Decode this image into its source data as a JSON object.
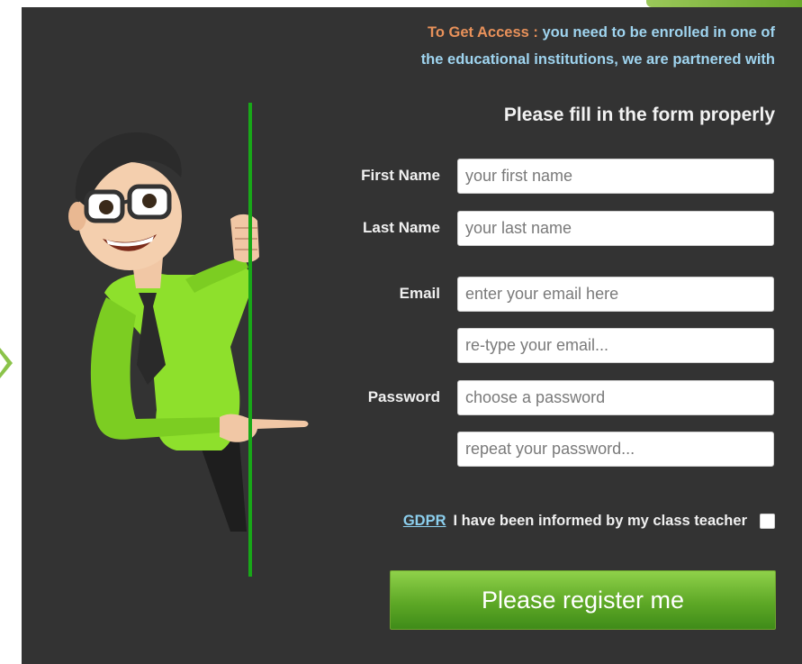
{
  "intro": {
    "lead": "To Get Access :",
    "line1": "you need to be enrolled in one of",
    "line2": "the educational institutions, we are partnered with"
  },
  "form": {
    "title": "Please fill in the form properly",
    "first_name": {
      "label": "First Name",
      "placeholder": "your first name"
    },
    "last_name": {
      "label": "Last Name",
      "placeholder": "your last name"
    },
    "email": {
      "label": "Email",
      "placeholder": "enter your email here",
      "confirm_placeholder": "re-type your email..."
    },
    "password": {
      "label": "Password",
      "placeholder": "choose a password",
      "confirm_placeholder": "repeat your password..."
    },
    "gdpr": {
      "link_text": "GDPR",
      "statement": "I have been informed by my class teacher",
      "checked": false
    },
    "submit_label": "Please register me"
  },
  "colors": {
    "panel_bg": "#333333",
    "accent_green": "#5ea826",
    "lead_orange": "#e8915a",
    "intro_blue": "#9fd4ef"
  }
}
